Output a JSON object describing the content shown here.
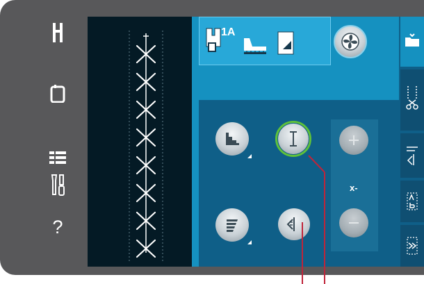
{
  "left_rail": {
    "icons": [
      "presser-foot-icon",
      "tablet-icon",
      "menu-list-icon",
      "tools-icon",
      "help-icon"
    ],
    "help_label": "?"
  },
  "stitch_preview": {
    "stitch_count": 8,
    "icon": "cross-stitch-icon"
  },
  "top_info": {
    "foot_label": "1A",
    "icons": [
      "presser-foot-icon",
      "stabilizer-icon",
      "needle-plate-icon"
    ],
    "option_button_icon": "fan-icon"
  },
  "controls": {
    "stitch_width_icon": "stitch-width-icon",
    "stitch_positioning_icon": "stitch-positioning-icon",
    "stitch_length_icon": "stitch-length-icon",
    "stitch_density_icon": "stitch-density-icon",
    "mirror_icon": "mirror-icon",
    "plus_icon": "plus-icon",
    "minus_icon": "minus-icon",
    "x_label": "x-"
  },
  "right_tabs": {
    "icons": [
      "folder-icon",
      "scissors-tab-icon",
      "sequence-tab-icon",
      "ab-tab-icon",
      "zigzag-tab-icon"
    ]
  },
  "colors": {
    "accent": "#1591c0",
    "selected_ring": "#5fc13a",
    "pointer": "#c0243a",
    "bezel": "#58585a"
  }
}
